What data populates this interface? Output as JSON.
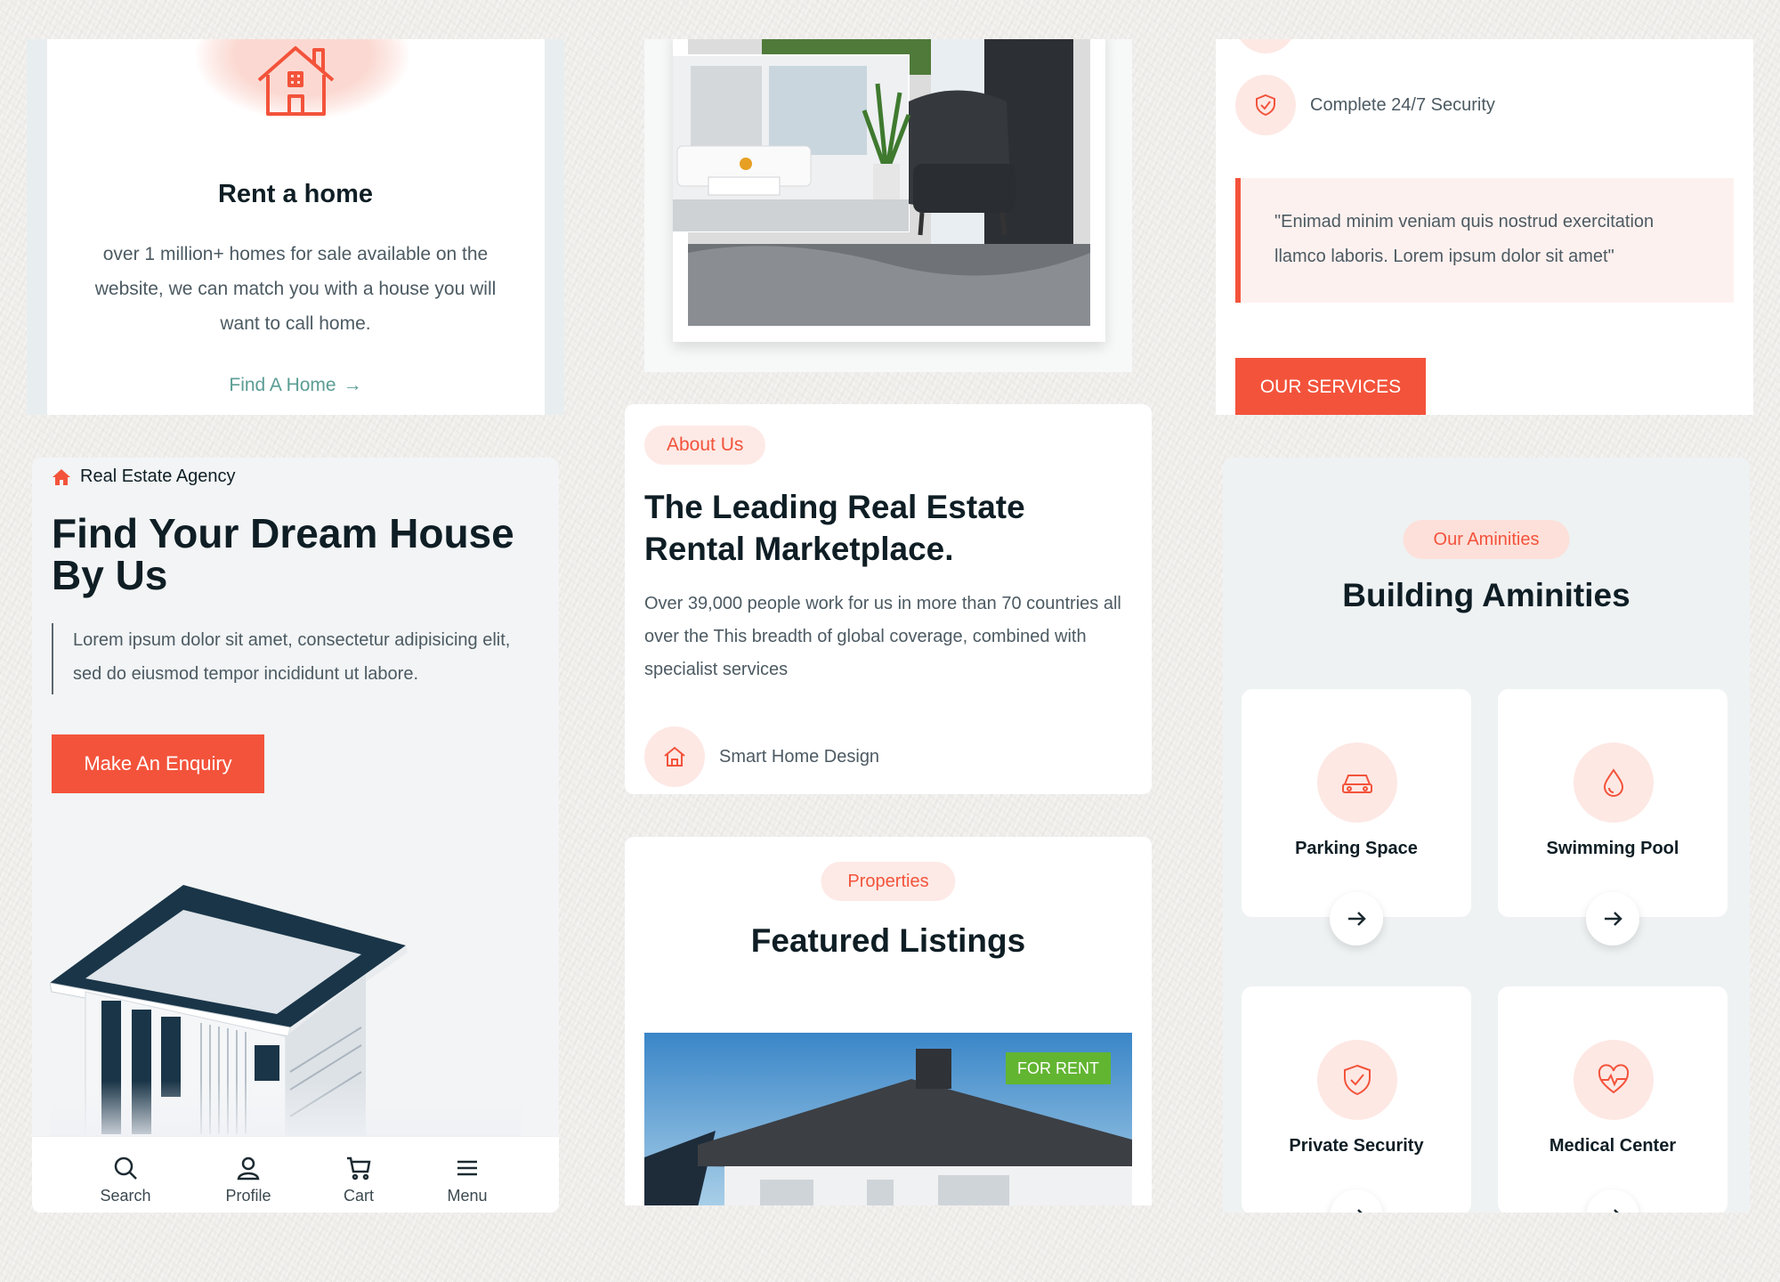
{
  "rent_card": {
    "title": "Rent a home",
    "description": "over 1 million+ homes for sale available on the website, we can match you with a house you will want to call home.",
    "link_label": "Find A Home",
    "link_arrow": "→"
  },
  "hero": {
    "agency_label": "Real Estate Agency",
    "headline": "Find Your Dream House By Us",
    "intro": "Lorem ipsum dolor sit amet, consectetur adipisicing elit, sed do eiusmod tempor incididunt ut labore.",
    "cta_label": "Make An Enquiry",
    "bottom_nav": [
      {
        "label": "Search",
        "icon": "search-icon"
      },
      {
        "label": "Profile",
        "icon": "user-icon"
      },
      {
        "label": "Cart",
        "icon": "cart-icon"
      },
      {
        "label": "Menu",
        "icon": "menu-icon"
      }
    ]
  },
  "about": {
    "tag": "About Us",
    "heading": "The Leading Real Estate Rental Marketplace.",
    "description": "Over 39,000 people work for us in more than 70 countries all over the This breadth of global coverage, combined with specialist services",
    "feature_label": "Smart Home Design",
    "feature_icon": "home-icon"
  },
  "featured": {
    "tag": "Properties",
    "heading": "Featured Listings",
    "badge": "FOR RENT"
  },
  "security_card": {
    "feature_label": "Complete 24/7 Security",
    "feature_icon": "shield-icon",
    "testimonial": "\"Enimad minim veniam quis nostrud exercitation llamco laboris. Lorem ipsum dolor sit amet\"",
    "cta_label": "OUR SERVICES"
  },
  "amenities": {
    "tag": "Our Aminities",
    "heading": "Building Aminities",
    "items": [
      {
        "label": "Parking Space",
        "icon": "car-icon"
      },
      {
        "label": "Swimming Pool",
        "icon": "water-drop-icon"
      },
      {
        "label": "Private Security",
        "icon": "shield-icon"
      },
      {
        "label": "Medical Center",
        "icon": "heart-pulse-icon"
      }
    ]
  },
  "colors": {
    "accent": "#f3533b",
    "accent_soft": "#fde8e4",
    "teal_link": "#5a9d94",
    "badge_green": "#62b531",
    "heading": "#0f1e25"
  }
}
